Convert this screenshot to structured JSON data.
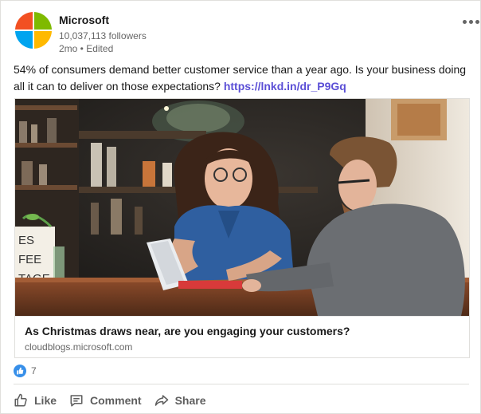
{
  "post": {
    "author": "Microsoft",
    "followers": "10,037,113 followers",
    "meta": "2mo • Edited",
    "more_icon": "more-horizontal-icon",
    "text": "54% of consumers demand better customer service than a year ago. Is your business doing all it can to deliver on those expectations? ",
    "link_text": "https://lnkd.in/dr_P9Gq"
  },
  "article": {
    "title": "As Christmas draws near, are you engaging your customers?",
    "domain": "cloudblogs.microsoft.com",
    "image_description_icon": "photo-two-people-with-tablet",
    "sign_text": [
      "ES",
      "FEE",
      "TAGE"
    ]
  },
  "reactions": {
    "icon": "like-reaction-icon",
    "count": "7"
  },
  "actions": [
    {
      "label": "Like",
      "icon": "thumbs-up-icon"
    },
    {
      "label": "Comment",
      "icon": "comment-icon"
    },
    {
      "label": "Share",
      "icon": "share-arrow-icon"
    }
  ],
  "colors": {
    "link": "#5b4fd6",
    "reaction_blue": "#378fe9",
    "ms_red": "#f25022",
    "ms_green": "#7fba00",
    "ms_blue": "#00a4ef",
    "ms_yellow": "#ffb900"
  }
}
